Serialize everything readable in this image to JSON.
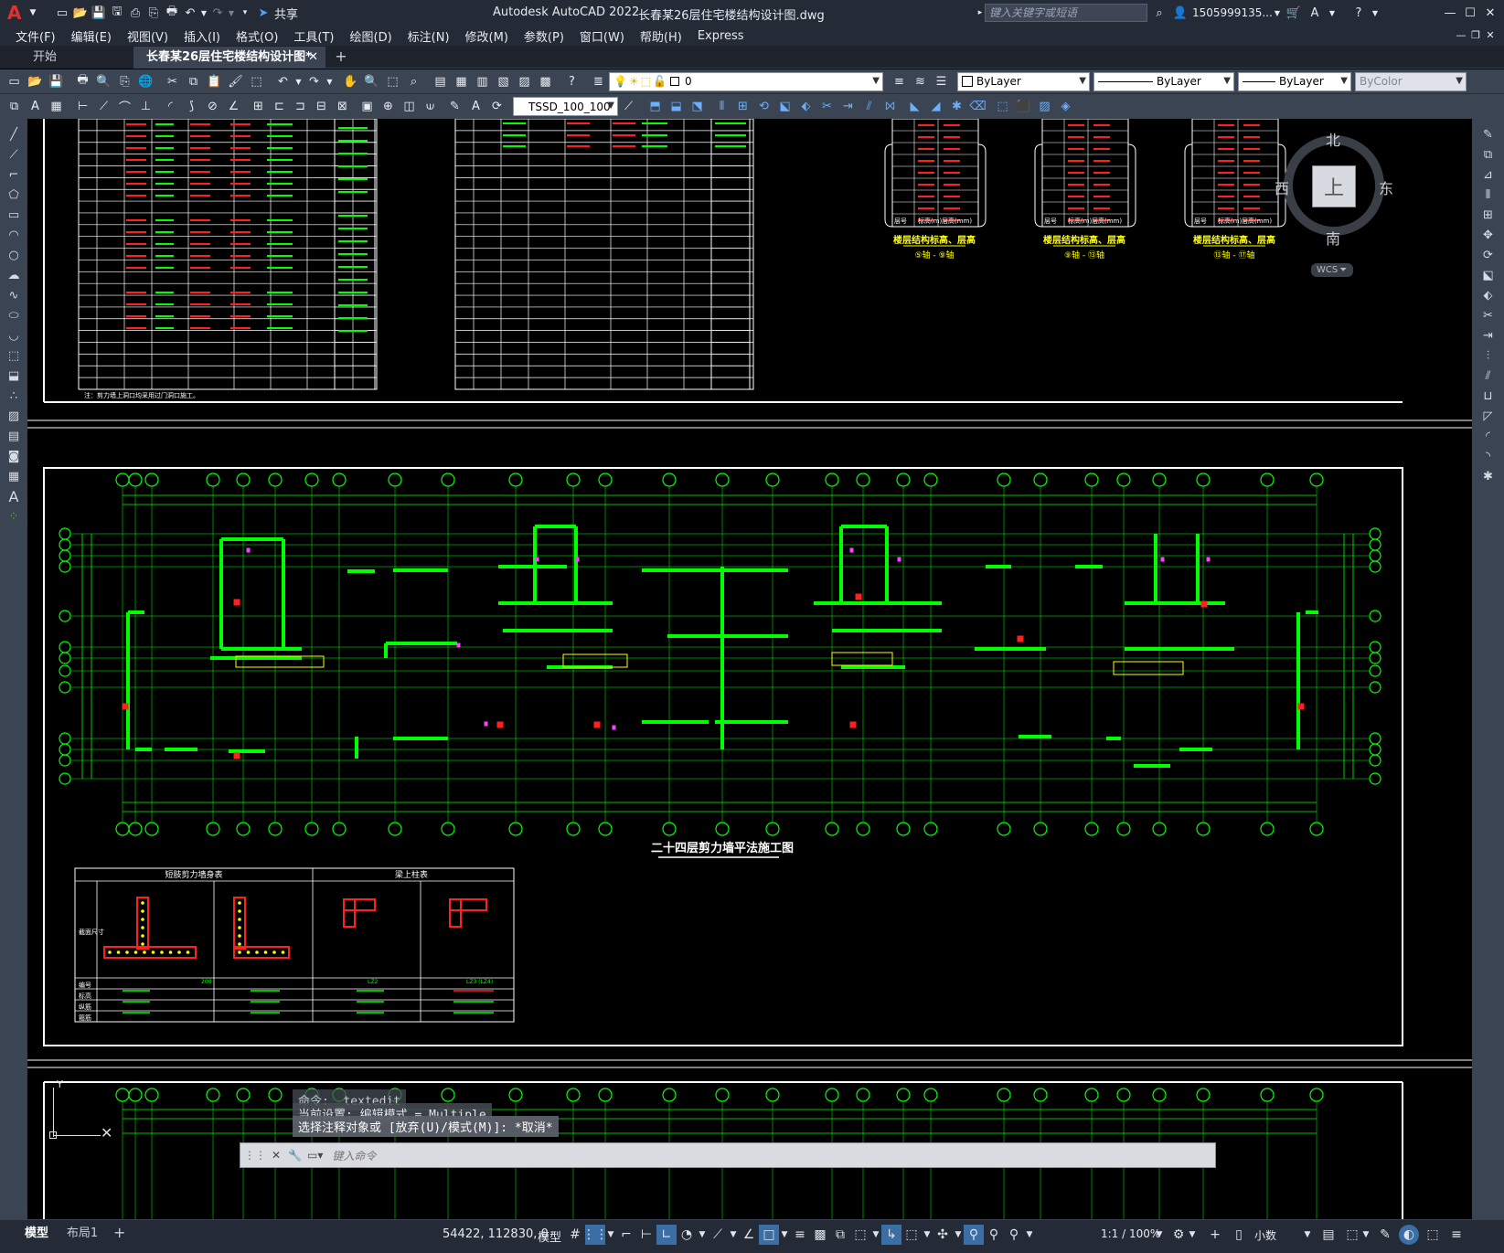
{
  "app": {
    "title_prefix": "Autodesk AutoCAD 2022",
    "file_title": "长春某26层住宅楼结构设计图.dwg",
    "share_label": "共享",
    "search_placeholder": "键入关键字或短语",
    "user": "1505999135...",
    "logo": "A"
  },
  "menu": [
    "文件(F)",
    "编辑(E)",
    "视图(V)",
    "插入(I)",
    "格式(O)",
    "工具(T)",
    "绘图(D)",
    "标注(N)",
    "修改(M)",
    "参数(P)",
    "窗口(W)",
    "帮助(H)",
    "Express"
  ],
  "tabs": [
    {
      "label": "开始",
      "active": false
    },
    {
      "label": "长春某26层住宅楼结构设计图*",
      "active": true
    }
  ],
  "layers": {
    "layer_value": "0",
    "color": "ByLayer",
    "linetype": "ByLayer",
    "lineweight": "ByLayer",
    "plotstyle": "ByColor",
    "dimstyle": "TSSD_100_100"
  },
  "viewcube": {
    "north": "北",
    "south": "南",
    "east": "东",
    "west": "西",
    "face": "上",
    "wcs": "WCS"
  },
  "drawing": {
    "plan_title": "二十四层剪力墙平法施工图",
    "table1_title": "短肢剪力墙身表",
    "table2_title": "梁上柱表",
    "table_rows": [
      "截面尺寸",
      "编号",
      "标高",
      "纵筋",
      "箍筋"
    ],
    "note": "注：剪力墙上洞口均采用过门洞口施工。",
    "elev_title": "楼层结构标高、层高",
    "table1_dim_label": "200",
    "table2_col_labels": [
      "LZ2",
      "LZ3 (LZ4)"
    ],
    "elev_col_headers": [
      "层号",
      "标高(m)",
      "层高(mm)"
    ],
    "elev_captions": [
      "⑤轴 - ⑨轴",
      "⑨轴 - ⑬轴",
      "⑬轴 - ⑰轴"
    ]
  },
  "command": {
    "line1": "命令: _textedit",
    "line2": "当前设置: 编辑模式 = Multiple",
    "line3": "选择注释对象或 [放弃(U)/模式(M)]: *取消*",
    "input_placeholder": "键入命令"
  },
  "status": {
    "model_tab": "模型",
    "layout_tab": "布局1",
    "coords": "54422, 112830, 0",
    "model": "模型",
    "scale": "1:1 / 100%",
    "units": "小数"
  },
  "colors": {
    "accent_green": "#00ff00",
    "red": "#ff2020",
    "yellow": "#ffff00",
    "magenta": "#ff40ff",
    "cyan": "#00ffff",
    "ui_bg": "#252b36",
    "toolbar_bg": "#3b4453"
  }
}
